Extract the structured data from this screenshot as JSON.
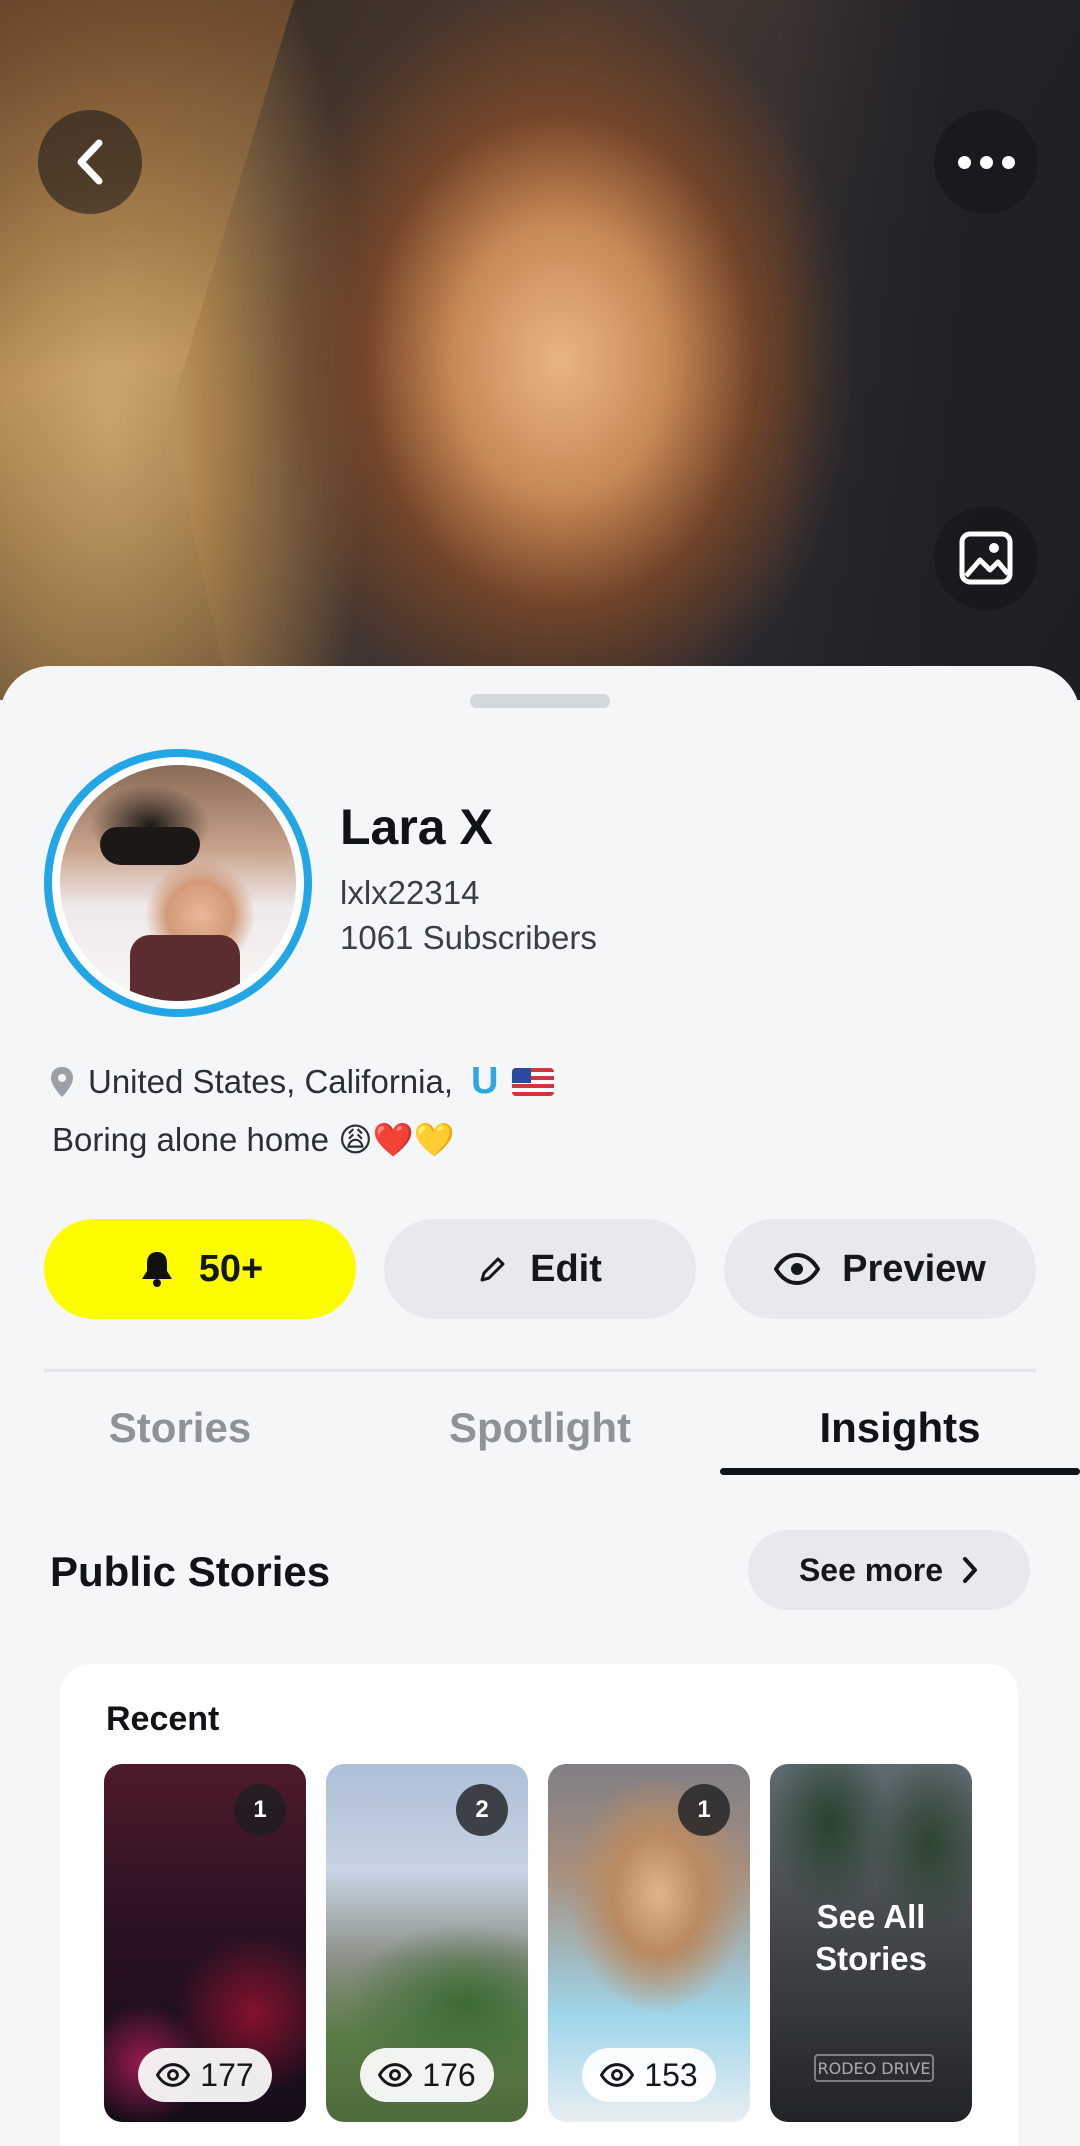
{
  "profile": {
    "name": "Lara X",
    "username": "lxlx22314",
    "subscribers": "1061 Subscribers",
    "location": "United States, California,",
    "location_badge": "U",
    "bio": "Boring alone home 😩❤️💛",
    "ring_color": "#22a6e6"
  },
  "actions": {
    "notifications_label": "50+",
    "edit_label": "Edit",
    "preview_label": "Preview",
    "accent_color": "#fffc00"
  },
  "tabs": [
    {
      "label": "Stories",
      "active": false
    },
    {
      "label": "Spotlight",
      "active": false
    },
    {
      "label": "Insights",
      "active": true
    }
  ],
  "public_stories": {
    "title": "Public Stories",
    "see_more_label": "See more",
    "recent_label": "Recent",
    "stories": [
      {
        "count": "1",
        "views": "177"
      },
      {
        "count": "2",
        "views": "176"
      },
      {
        "count": "1",
        "views": "153"
      }
    ],
    "see_all_label": "See All Stories",
    "sign_text": "RODEO DRIVE"
  },
  "icons": {
    "back": "chevron-left-icon",
    "more": "more-horizontal-icon",
    "photo": "image-icon",
    "location": "map-pin-icon",
    "bell": "bell-icon",
    "pencil": "pencil-icon",
    "eye": "eye-icon",
    "chevron": "chevron-right-icon"
  }
}
